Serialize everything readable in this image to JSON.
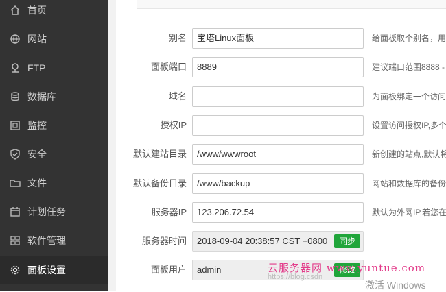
{
  "sidebar": {
    "items": [
      {
        "label": "首页",
        "icon": "home-icon"
      },
      {
        "label": "网站",
        "icon": "globe-icon"
      },
      {
        "label": "FTP",
        "icon": "ftp-icon"
      },
      {
        "label": "数据库",
        "icon": "database-icon"
      },
      {
        "label": "监控",
        "icon": "monitor-icon"
      },
      {
        "label": "安全",
        "icon": "shield-icon"
      },
      {
        "label": "文件",
        "icon": "folder-icon"
      },
      {
        "label": "计划任务",
        "icon": "calendar-icon"
      },
      {
        "label": "软件管理",
        "icon": "apps-grid-icon"
      },
      {
        "label": "面板设置",
        "icon": "gear-icon"
      }
    ],
    "active": "面板设置"
  },
  "form": {
    "rows": [
      {
        "label": "别名",
        "value": "宝塔Linux面板",
        "hint": "给面板取个别名，用"
      },
      {
        "label": "面板端口",
        "value": "8889",
        "hint": "建议端口范围8888 -"
      },
      {
        "label": "域名",
        "value": "",
        "hint": "为面板绑定一个访问"
      },
      {
        "label": "授权IP",
        "value": "",
        "hint": "设置访问授权IP,多个"
      },
      {
        "label": "默认建站目录",
        "value": "/www/wwwroot",
        "hint": "新创建的站点,默认将"
      },
      {
        "label": "默认备份目录",
        "value": "/www/backup",
        "hint": "网站和数据库的备份"
      },
      {
        "label": "服务器IP",
        "value": "123.206.72.54",
        "hint": "默认为外网IP,若您在"
      },
      {
        "label": "服务器时间",
        "value": "2018-09-04 20:38:57 CST +0800",
        "button": "同步"
      },
      {
        "label": "面板用户",
        "value": "admin",
        "button": "修改"
      }
    ]
  },
  "watermark": {
    "site": "云服务器网 www.yuntue.com",
    "activate": "激活 Windows",
    "blog": "https://blog.csdn"
  },
  "colors": {
    "sidebar_bg": "#333333",
    "accent_green": "#20a53a",
    "watermark_pink": "#e33c8a"
  }
}
